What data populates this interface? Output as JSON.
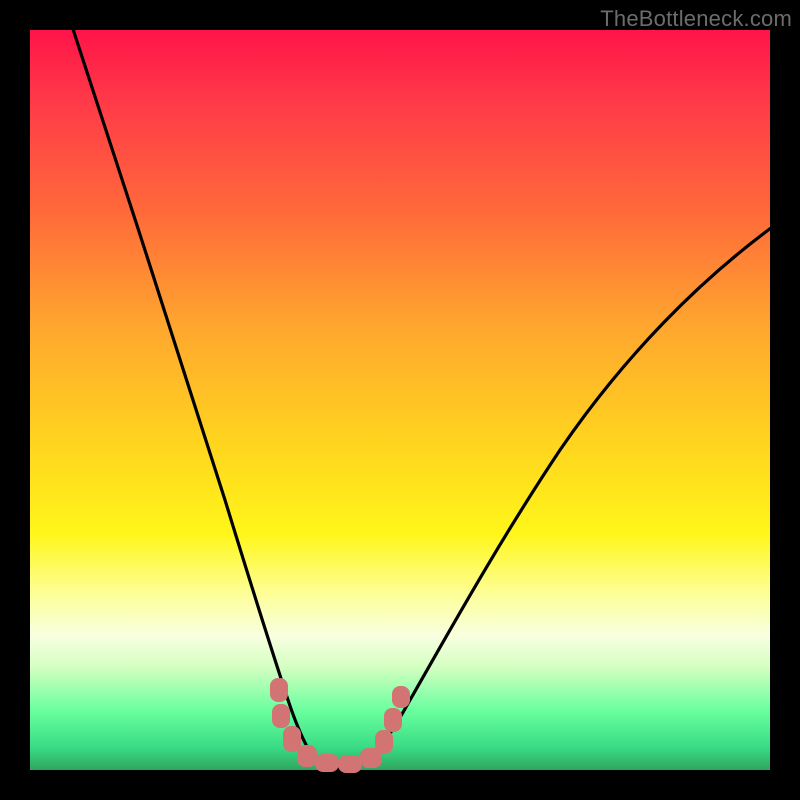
{
  "watermark": "TheBottleneck.com",
  "colors": {
    "gradient_top": "#ff1449",
    "gradient_mid": "#ffd21f",
    "gradient_bottom": "#2fa55e",
    "curve": "#000000",
    "markers": "#d37474",
    "frame": "#000000"
  },
  "chart_data": {
    "type": "line",
    "title": "",
    "xlabel": "",
    "ylabel": "",
    "xlim": [
      0,
      100
    ],
    "ylim": [
      0,
      100
    ],
    "grid": false,
    "legend": false,
    "comment": "Two curves forming a V/valley shape; no axis tick labels are rendered, values approximate height ratio in percent.",
    "x": [
      0,
      5,
      10,
      15,
      20,
      25,
      27,
      29,
      31,
      33,
      35,
      36,
      37,
      38,
      40,
      43,
      45,
      47,
      50,
      55,
      60,
      65,
      70,
      75,
      80,
      85,
      90,
      95,
      100
    ],
    "series": [
      {
        "name": "left-branch",
        "values": [
          100,
          90,
          79,
          67,
          54,
          41,
          35,
          28,
          21,
          14,
          8,
          5,
          3,
          1,
          0,
          null,
          null,
          null,
          null,
          null,
          null,
          null,
          null,
          null,
          null,
          null,
          null,
          null,
          null
        ]
      },
      {
        "name": "right-branch",
        "values": [
          null,
          null,
          null,
          null,
          null,
          null,
          null,
          null,
          null,
          null,
          null,
          null,
          null,
          0,
          1,
          3,
          5,
          8,
          13,
          22,
          31,
          39,
          46,
          52,
          58,
          63,
          67,
          71,
          74
        ]
      }
    ],
    "markers": {
      "name": "floor-markers",
      "x": [
        27.5,
        27.8,
        30,
        32,
        34,
        36,
        38,
        40,
        42.5,
        43,
        44.5,
        45
      ],
      "values": [
        10,
        7,
        3,
        1.5,
        1,
        1,
        1,
        1.5,
        4,
        7,
        9,
        12
      ]
    }
  }
}
